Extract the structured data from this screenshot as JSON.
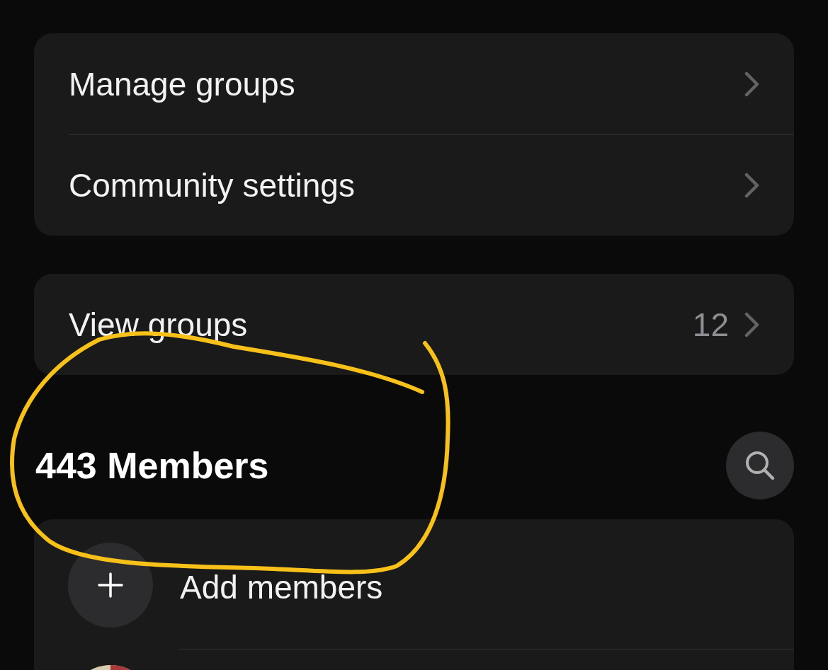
{
  "sections": [
    {
      "rows": [
        {
          "label": "Manage groups"
        },
        {
          "label": "Community settings"
        }
      ]
    },
    {
      "rows": [
        {
          "label": "View groups",
          "count": "12"
        }
      ]
    }
  ],
  "members": {
    "title": "443 Members",
    "items": [
      {
        "kind": "action",
        "label": "Add members"
      },
      {
        "kind": "member"
      }
    ]
  }
}
